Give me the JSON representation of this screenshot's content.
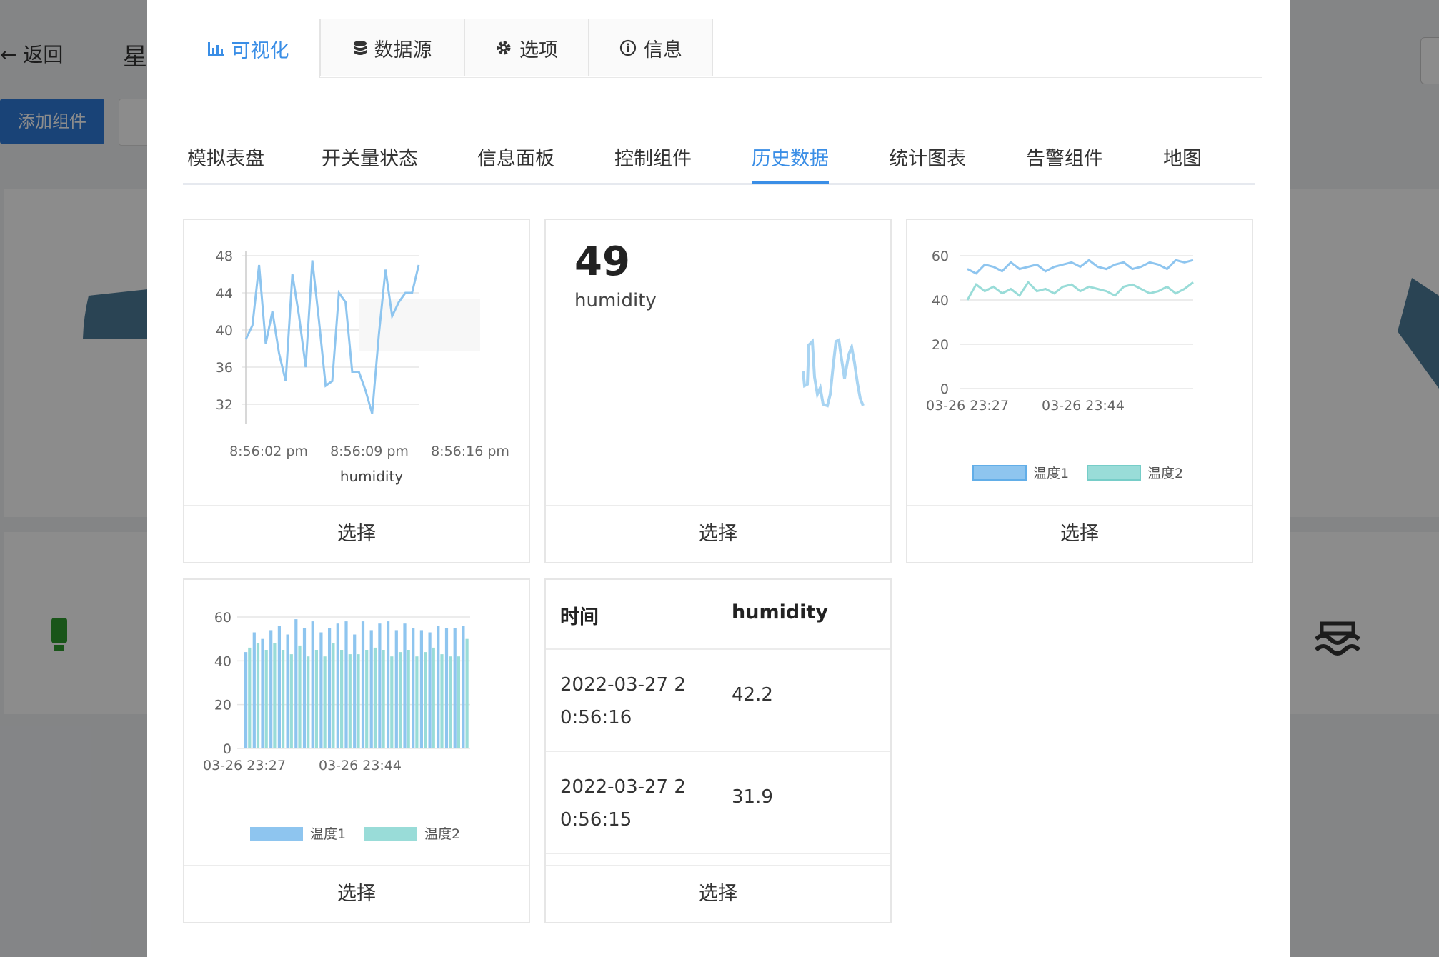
{
  "background": {
    "back_label": "返回",
    "title_fragment": "星",
    "add_component_label": "添加组件"
  },
  "modal": {
    "top_tabs": [
      {
        "label": "可视化",
        "icon": "bar-chart-icon",
        "active": true
      },
      {
        "label": "数据源",
        "icon": "database-icon",
        "active": false
      },
      {
        "label": "选项",
        "icon": "gear-icon",
        "active": false
      },
      {
        "label": "信息",
        "icon": "info-icon",
        "active": false
      }
    ],
    "sub_tabs": [
      {
        "label": "模拟表盘"
      },
      {
        "label": "开关量状态"
      },
      {
        "label": "信息面板"
      },
      {
        "label": "控制组件"
      },
      {
        "label": "历史数据",
        "active": true
      },
      {
        "label": "统计图表"
      },
      {
        "label": "告警组件"
      },
      {
        "label": "地图"
      }
    ],
    "select_label": "选择",
    "cards": {
      "line_chart": {
        "y_ticks": [
          "48",
          "44",
          "40",
          "36",
          "32"
        ],
        "x_ticks": [
          "8:56:02 pm",
          "8:56:09 pm",
          "8:56:16 pm"
        ],
        "xlabel": "humidity"
      },
      "big_number": {
        "value": "49",
        "label": "humidity"
      },
      "multi_line": {
        "y_ticks": [
          "60",
          "40",
          "20",
          "0"
        ],
        "x_ticks": [
          "03-26 23:27",
          "03-26 23:44"
        ],
        "legend": [
          "温度1",
          "温度2"
        ]
      },
      "bar_chart": {
        "y_ticks": [
          "60",
          "40",
          "20",
          "0"
        ],
        "x_ticks": [
          "03-26 23:27",
          "03-26 23:44"
        ],
        "legend": [
          "温度1",
          "温度2"
        ]
      },
      "table": {
        "headers": [
          "时间",
          "humidity"
        ],
        "rows": [
          {
            "time": "2022-03-27 20:56:16",
            "value": "42.2"
          },
          {
            "time": "2022-03-27 20:56:15",
            "value": "31.9"
          }
        ]
      }
    }
  },
  "chart_data": [
    {
      "type": "line",
      "x": [
        0,
        1,
        2,
        3,
        4,
        5,
        6,
        7,
        8,
        9,
        10,
        11,
        12,
        13,
        14,
        15,
        16,
        17,
        18,
        19,
        20,
        21,
        22,
        23,
        24,
        25,
        26,
        27,
        28
      ],
      "values": [
        39,
        40.5,
        47,
        38.5,
        42,
        37.5,
        34.5,
        46,
        41.5,
        36,
        47.5,
        41,
        34,
        34.5,
        44,
        43,
        35.5,
        35.5,
        33.5,
        31,
        39.5,
        46.5,
        41.5,
        43,
        44,
        44,
        47
      ],
      "xlabel": "humidity",
      "ylim": [
        30,
        48
      ],
      "series": [
        {
          "color": "#8ec5ef"
        }
      ]
    },
    {
      "type": "line",
      "categories": [
        "03-26 23:27",
        "03-26 23:44"
      ],
      "ylim": [
        0,
        60
      ],
      "series": [
        {
          "name": "温度1",
          "color": "#8ec5ef",
          "values": [
            54,
            52,
            56,
            55,
            53,
            57,
            54,
            55,
            56,
            53,
            55,
            56,
            57,
            55,
            58,
            55,
            54,
            56,
            57,
            54,
            55,
            57,
            56,
            54,
            58,
            57,
            58
          ]
        },
        {
          "name": "温度2",
          "color": "#99dcd8",
          "values": [
            40,
            47,
            44,
            46,
            43,
            45,
            42,
            48,
            44,
            45,
            43,
            46,
            47,
            44,
            46,
            45,
            44,
            42,
            46,
            47,
            45,
            43,
            44,
            46,
            43,
            45,
            48
          ]
        }
      ]
    },
    {
      "type": "bar",
      "categories": [
        "03-26 23:27",
        "03-26 23:44"
      ],
      "ylim": [
        0,
        60
      ],
      "series": [
        {
          "name": "温度1",
          "color": "#8ec5ef",
          "values": [
            44,
            53,
            50,
            54,
            56,
            52,
            59,
            55,
            58,
            53,
            55,
            57,
            58,
            52,
            58,
            54,
            57,
            58,
            54,
            57,
            55,
            54,
            53,
            56,
            55,
            55,
            56
          ]
        },
        {
          "name": "温度2",
          "color": "#99dcd8",
          "values": [
            46,
            48,
            45,
            48,
            45,
            43,
            47,
            42,
            45,
            42,
            48,
            45,
            43,
            43,
            45,
            46,
            45,
            42,
            44,
            45,
            42,
            44,
            46,
            43,
            42,
            42,
            50
          ]
        }
      ]
    }
  ]
}
